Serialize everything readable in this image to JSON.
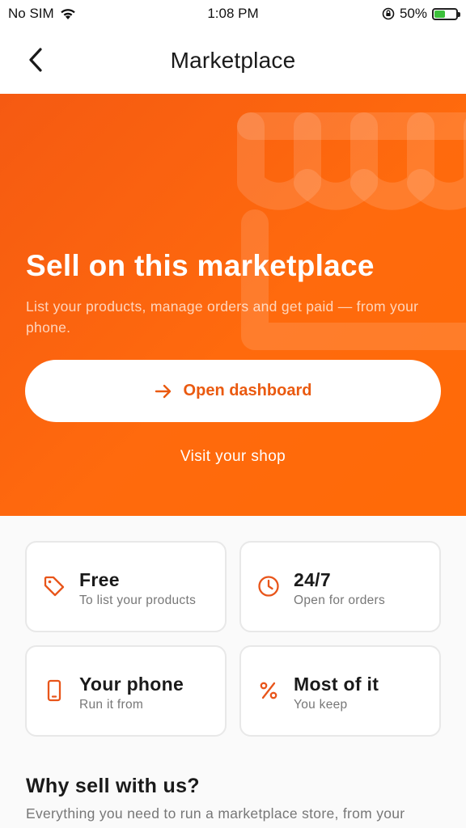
{
  "status_bar": {
    "carrier": "No SIM",
    "time": "1:08 PM",
    "battery_percent": "50%",
    "battery_level": 0.5
  },
  "nav": {
    "title": "Marketplace",
    "back_icon": "chevron-left-icon"
  },
  "hero": {
    "title": "Sell on this marketplace",
    "subtitle": "List your products, manage orders and get paid — from your phone.",
    "primary_button_label": "Open dashboard",
    "primary_button_icon": "arrow-right-icon",
    "secondary_link_label": "Visit your shop",
    "background_color": "#ff6a07",
    "accent_color": "#ea5a10",
    "decor_icon": "storefront-icon"
  },
  "stats": [
    {
      "icon": "tag-icon",
      "value": "Free",
      "label": "To list your products"
    },
    {
      "icon": "clock-icon",
      "value": "24/7",
      "label": "Open for orders"
    },
    {
      "icon": "phone-icon",
      "value": "Your phone",
      "label": "Run it from"
    },
    {
      "icon": "percent-icon",
      "value": "Most of it",
      "label": "You keep"
    }
  ],
  "why": {
    "title": "Why sell with us?",
    "body": "Everything you need to run a marketplace store, from your"
  }
}
